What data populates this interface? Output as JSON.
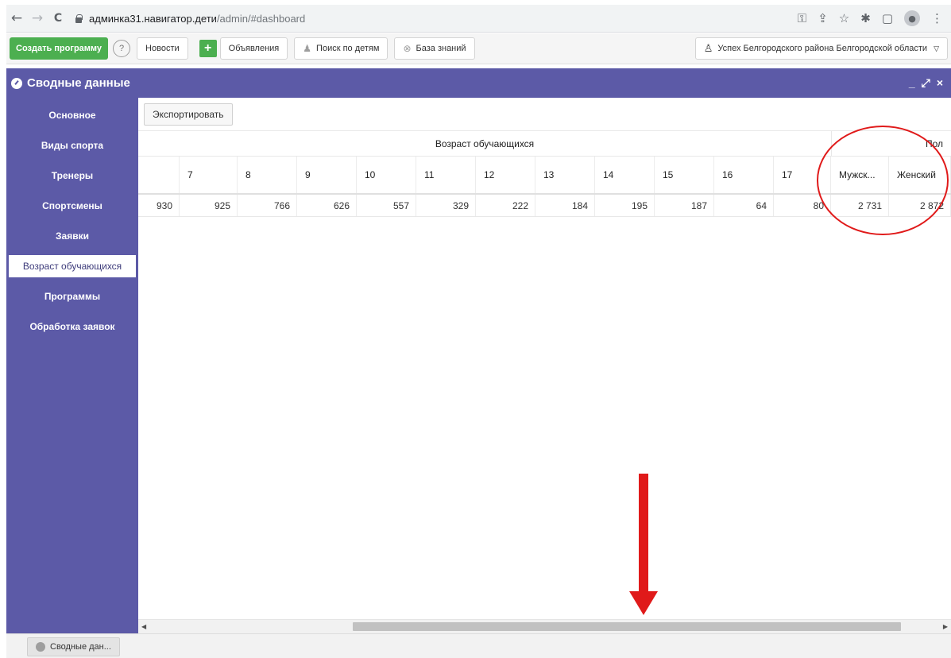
{
  "browser": {
    "url_host": "админка31.навигатор.дети",
    "url_path": "/admin/#dashboard",
    "back_glyph": "←",
    "forward_glyph": "→",
    "reload_glyph": "C",
    "action_icons": [
      "key-icon",
      "share-icon",
      "star-icon",
      "extensions-icon",
      "sidepanel-icon",
      "profile-icon",
      "menu-icon"
    ]
  },
  "toolbar": {
    "create_label": "Создать программу",
    "help_glyph": "?",
    "news_label": "Новости",
    "plus_glyph": "+",
    "ads_label": "Объявления",
    "search_children_label": "Поиск по детям",
    "knowledge_label": "База знаний",
    "user_label": "Успех Белгородского района Белгородской области"
  },
  "panel": {
    "title": "Сводные данные",
    "minimize_glyph": "_",
    "close_glyph": "×"
  },
  "sidebar": {
    "items": [
      {
        "label": "Основное",
        "active": false
      },
      {
        "label": "Виды спорта",
        "active": false
      },
      {
        "label": "Тренеры",
        "active": false
      },
      {
        "label": "Спортсмены",
        "active": false
      },
      {
        "label": "Заявки",
        "active": false
      },
      {
        "label": "Возраст обучающихся",
        "active": true
      },
      {
        "label": "Программы",
        "active": false
      },
      {
        "label": "Обработка заявок",
        "active": false
      }
    ]
  },
  "main": {
    "export_label": "Экспортировать",
    "group_age_label": "Возраст обучающихся",
    "group_sex_label": "Пол",
    "columns": [
      "",
      "7",
      "8",
      "9",
      "10",
      "11",
      "12",
      "13",
      "14",
      "15",
      "16",
      "17",
      "Мужск...",
      "Женский"
    ],
    "values": [
      "930",
      "925",
      "766",
      "626",
      "557",
      "329",
      "222",
      "184",
      "195",
      "187",
      "64",
      "80",
      "2 731",
      "2 872"
    ]
  },
  "annotations": {
    "highlight_color": "#e01a1a",
    "arrow_color": "#e01a1a"
  },
  "taskbar": {
    "window_label": "Сводные дан..."
  },
  "colors": {
    "panel_header": "#5c5aa7",
    "create_button": "#4caf50"
  }
}
